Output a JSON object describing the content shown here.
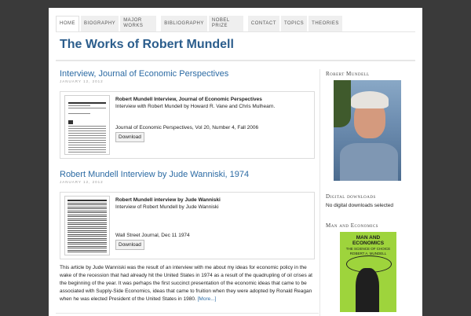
{
  "nav": [
    {
      "label": "Home",
      "active": true
    },
    {
      "label": "Biography"
    },
    {
      "label": "Major Works"
    },
    {
      "label": "Bibliography",
      "gap": true
    },
    {
      "label": "Nobel Prize"
    },
    {
      "label": "Contact",
      "gap": true
    },
    {
      "label": "Topics"
    },
    {
      "label": "Theories"
    }
  ],
  "site_title": "The Works of Robert Mundell",
  "posts": [
    {
      "title": "Interview, Journal of Economic Perspectives",
      "date": "January 12, 2012",
      "card_title": "Robert Mundell Interview, Journal of Economic Perspectives",
      "card_desc": "Interview with Robert Mundell by Howard R. Vane and Chris Mulhearn.",
      "card_source": "Journal of Economic Perspectives, Vol 20, Number 4, Fall 2006",
      "download_label": "Download"
    },
    {
      "title": "Robert Mundell Interview by Jude Wanniski, 1974",
      "date": "January 12, 2012",
      "card_title": "Robert Mundell interview by Jude Wanniski",
      "card_desc": "Interview of Robert Mundell by Jude Wanniski",
      "card_source": "Wall Street Journal, Dec 11 1974",
      "download_label": "Download",
      "excerpt": "This article by Jude Wanniski was the result of an interview with me about my ideas for economic policy in the wake of the recession that had already hit the United States in 1974 as a result of the quadrupling of oil crises at the beginning of the year. It was perhaps the first succinct presentation of the economic ideas that came to be associated with Supply-Side Economics, ideas that came to fruition when they were adopted by Ronald Reagan when he was elected President of the United States in 1980.",
      "more_label": "[More...]"
    }
  ],
  "sidebar": {
    "portrait_heading": "Robert Mundell",
    "downloads_heading": "Digital downloads",
    "downloads_text": "No digital downloads selected",
    "book_heading": "Man and Economics",
    "book_title": "MAN AND ECONOMICS",
    "book_subtitle": "THE SCIENCE OF CHOICE",
    "book_author": "ROBERT A. MUNDELL"
  }
}
